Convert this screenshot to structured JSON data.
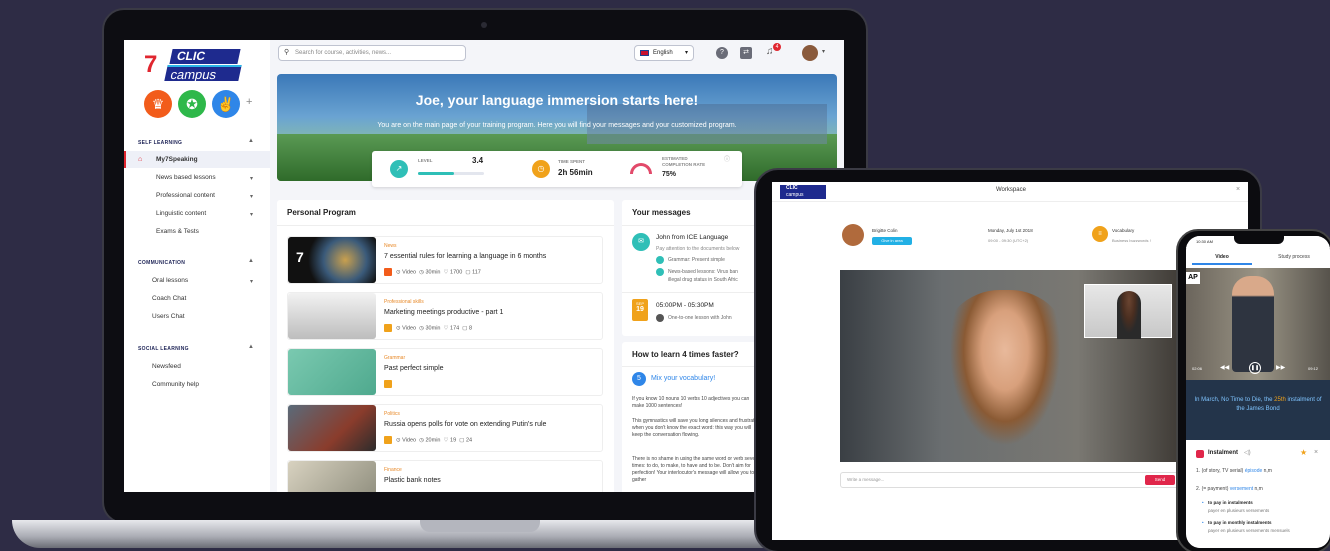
{
  "brand": {
    "clic": "CLIC",
    "campus": "campus"
  },
  "topbar": {
    "search_placeholder": "Search for course, activities, news...",
    "language": "English",
    "notif_count": "4"
  },
  "sidebar": {
    "self_learning": "SELF LEARNING",
    "self_items": [
      "My7Speaking",
      "News based lessons",
      "Professional content",
      "Linguistic content",
      "Exams & Tests"
    ],
    "communication": "COMMUNICATION",
    "comm_items": [
      "Oral lessons",
      "Coach Chat",
      "Users Chat"
    ],
    "social": "SOCIAL LEARNING",
    "social_items": [
      "Newsfeed",
      "Community help"
    ]
  },
  "hero": {
    "title": "Joe, your language immersion starts here!",
    "subtitle": "You are on the main page of your training program. Here you will find your messages and your customized program."
  },
  "stats": {
    "level_label": "LEVEL",
    "level_value": "3.4",
    "level_progress": 0.55,
    "time_label": "TIME SPENT",
    "time_value": "2h 56min",
    "completion_label_1": "ESTIMATED",
    "completion_label_2": "COMPLETION RATE",
    "completion_value": "75%"
  },
  "program": {
    "title": "Personal Program",
    "items": [
      {
        "category": "News",
        "title": "7 essential rules for learning a language in 6 months",
        "num": "7",
        "type": "Video",
        "duration": "30min",
        "likes": "1700",
        "comments": "117"
      },
      {
        "category": "Professional skills",
        "title": "Marketing meetings productive - part 1",
        "num": "8",
        "type": "Video",
        "duration": "30min",
        "likes": "174",
        "comments": "8"
      },
      {
        "category": "Grammar",
        "title": "Past perfect simple",
        "num": "",
        "type": "",
        "duration": "",
        "likes": "",
        "comments": ""
      },
      {
        "category": "Politics",
        "title": "Russia opens polls for vote on extending Putin's rule",
        "num": "",
        "type": "Video",
        "duration": "20min",
        "likes": "19",
        "comments": "24"
      },
      {
        "category": "Finance",
        "title": "Plastic bank notes",
        "num": "",
        "type": "",
        "duration": "",
        "likes": "",
        "comments": ""
      }
    ]
  },
  "messages": {
    "title": "Your messages",
    "sender": "John from ICE Language",
    "preview": "Pay attention to the documents below",
    "lines": [
      "Grammar: Present simple",
      "News-based lessons: Virus ban",
      "illegal drug status in South Afric"
    ],
    "month": "SEP",
    "day": "19",
    "slot": "05:00PM - 05:30PM",
    "slot_desc": "One-to-one lesson with John"
  },
  "tip": {
    "title": "How to learn 4 times faster?",
    "step": "5",
    "step_title": "Mix your vocabulary!",
    "p1": "If you know 10 nouns 10 verbs 10 adjectives you can make 1000 sentences!",
    "p2": "This gymnastics will save you long silences and frustration when you don't know the exact word: this way you will keep the conversation flowing.",
    "p3": "There is no shame in using the same word or verb several times: to do, to make, to have and to be. Don't aim for perfection! Your interlocutor's message will allow you to gather"
  },
  "tablet": {
    "title": "Workspace",
    "person": "Brigitte Colin",
    "join": "Give in area",
    "date": "Monday, July 1st 2018",
    "time": "09:00 - 09:30 (UTC+2)",
    "topic": "Vocabulary",
    "topic_sub": "Business buzzwords !",
    "message_placeholder": "Write a message...",
    "send": "Send"
  },
  "phone": {
    "time": "10:30 AM",
    "tab_video": "Video",
    "tab_study": "Study process",
    "ap": "AP",
    "t_start": "02:06",
    "t_end": "09:12",
    "caption_1": "In March, No Time to Die, the",
    "caption_hl": "25th",
    "caption_2": "instalment of the James Bond",
    "word": "Instalment",
    "def1_num": "1.",
    "def1": "(of story, TV serial)",
    "def1_fr": "épisode",
    "def1_pos": "n,m",
    "def2_num": "2.",
    "def2": "(= payment)",
    "def2_fr": "versement",
    "def2_pos": "n,m",
    "ex1": "to pay in instalments",
    "ex1_fr": "payer en plusieurs versements",
    "ex2": "to pay in monthly instalments",
    "ex2_fr": "payer en plusieurs versements mensuels"
  },
  "colors": {
    "navy": "#1d2356",
    "orange": "#f0a21b",
    "teal": "#2fbfb7",
    "red": "#e0262f"
  }
}
